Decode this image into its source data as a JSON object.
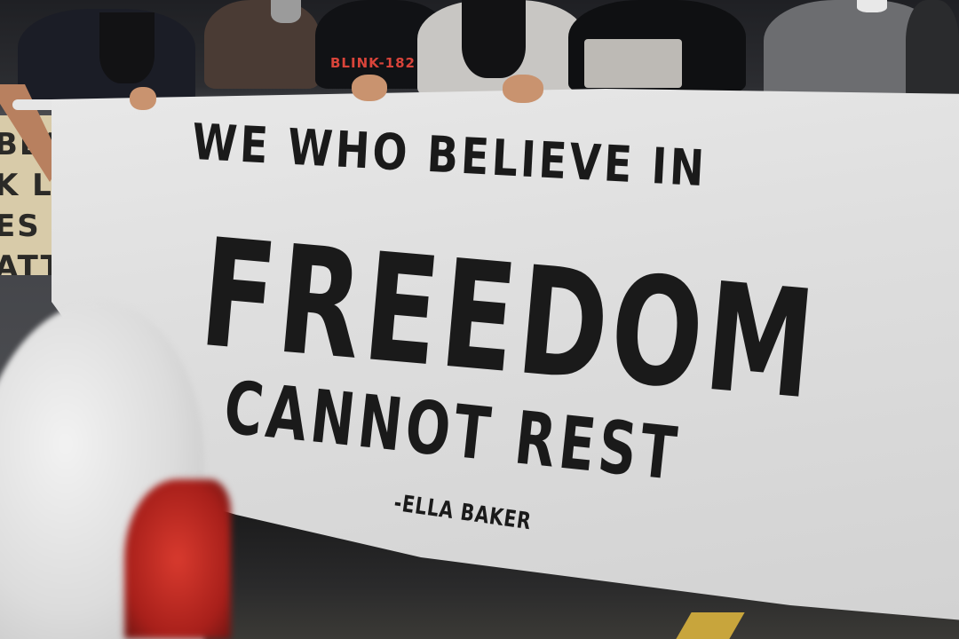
{
  "banner": {
    "line1": "WE WHO BELIEVE IN",
    "line2": "FREEDOM",
    "line3": "CANNOT REST",
    "attribution": "-ELLA BAKER"
  },
  "background": {
    "tshirt_text": "BLINK-182",
    "side_sign_text": "BLACK LIVES MATTER"
  },
  "colors": {
    "banner": "#e0e0e0",
    "ink": "#1a1a1a",
    "taillight": "#c62f25"
  }
}
